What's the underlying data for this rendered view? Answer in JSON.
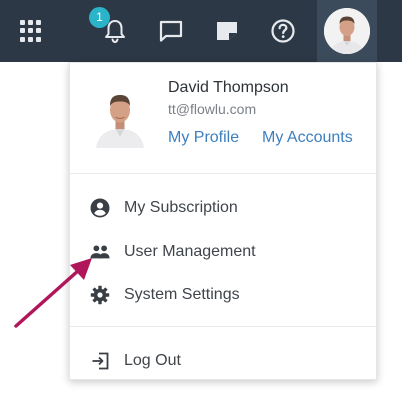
{
  "topbar": {
    "notification_count": "1",
    "icons": {
      "apps": "apps-grid-icon",
      "notifications": "bell-icon",
      "messages": "chat-icon",
      "notes": "note-icon",
      "help": "help-icon"
    },
    "colors": {
      "background": "#2c3845",
      "badge": "#2bb3c9",
      "avatar_bg": "#3c4b5b"
    }
  },
  "dropdown": {
    "user_name": "David Thompson",
    "user_email": "tt@flowlu.com",
    "links": {
      "profile": "My Profile",
      "accounts": "My Accounts"
    },
    "menu": [
      {
        "label": "My Subscription",
        "icon": "account-circle-icon"
      },
      {
        "label": "User Management",
        "icon": "users-icon"
      },
      {
        "label": "System Settings",
        "icon": "gear-icon"
      }
    ],
    "logout": {
      "label": "Log Out",
      "icon": "logout-icon"
    },
    "colors": {
      "link": "#3d7fbf",
      "arrow": "#b0175a"
    }
  }
}
